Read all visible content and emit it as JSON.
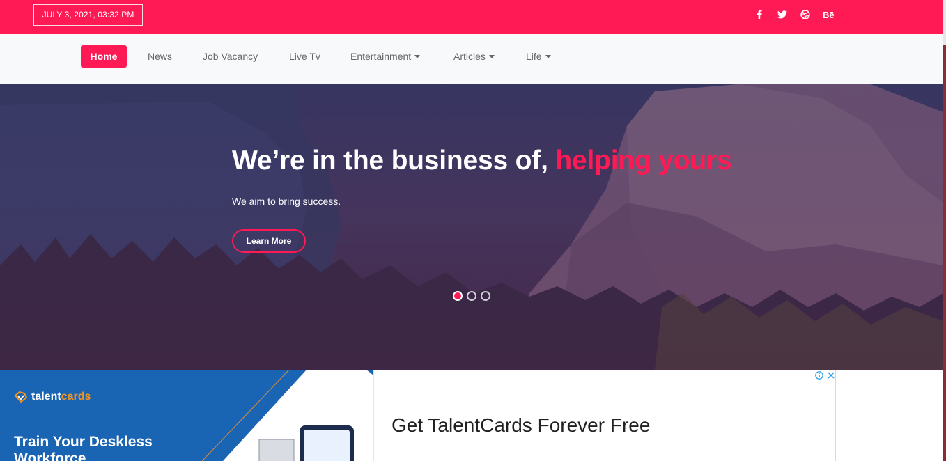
{
  "topbar": {
    "date": "JULY 3, 2021, 03:32 PM",
    "social_icons": [
      "facebook-icon",
      "twitter-icon",
      "dribbble-icon",
      "behance-icon"
    ],
    "behance_label": "Bē",
    "color": "#ff1a55"
  },
  "nav": {
    "items": [
      {
        "label": "Home",
        "active": true
      },
      {
        "label": "News"
      },
      {
        "label": "Job Vacancy"
      },
      {
        "label": "Live Tv"
      },
      {
        "label": "Entertainment",
        "dropdown": true
      },
      {
        "label": "Articles",
        "dropdown": true
      },
      {
        "label": "Life",
        "dropdown": true
      }
    ]
  },
  "hero": {
    "title_prefix": "We’re in the business of,",
    "title_accent": "helping yours",
    "subtitle": "We aim to bring success.",
    "button": "Learn More",
    "slides": 3,
    "active_slide": 1
  },
  "ad": {
    "brand_talent": "talent",
    "brand_cards": "cards",
    "headline": "Train Your Deskless Workforce",
    "cta": "Get TalentCards Forever Free",
    "info_icon": "adchoices-info-icon",
    "close_icon": "close-icon"
  }
}
